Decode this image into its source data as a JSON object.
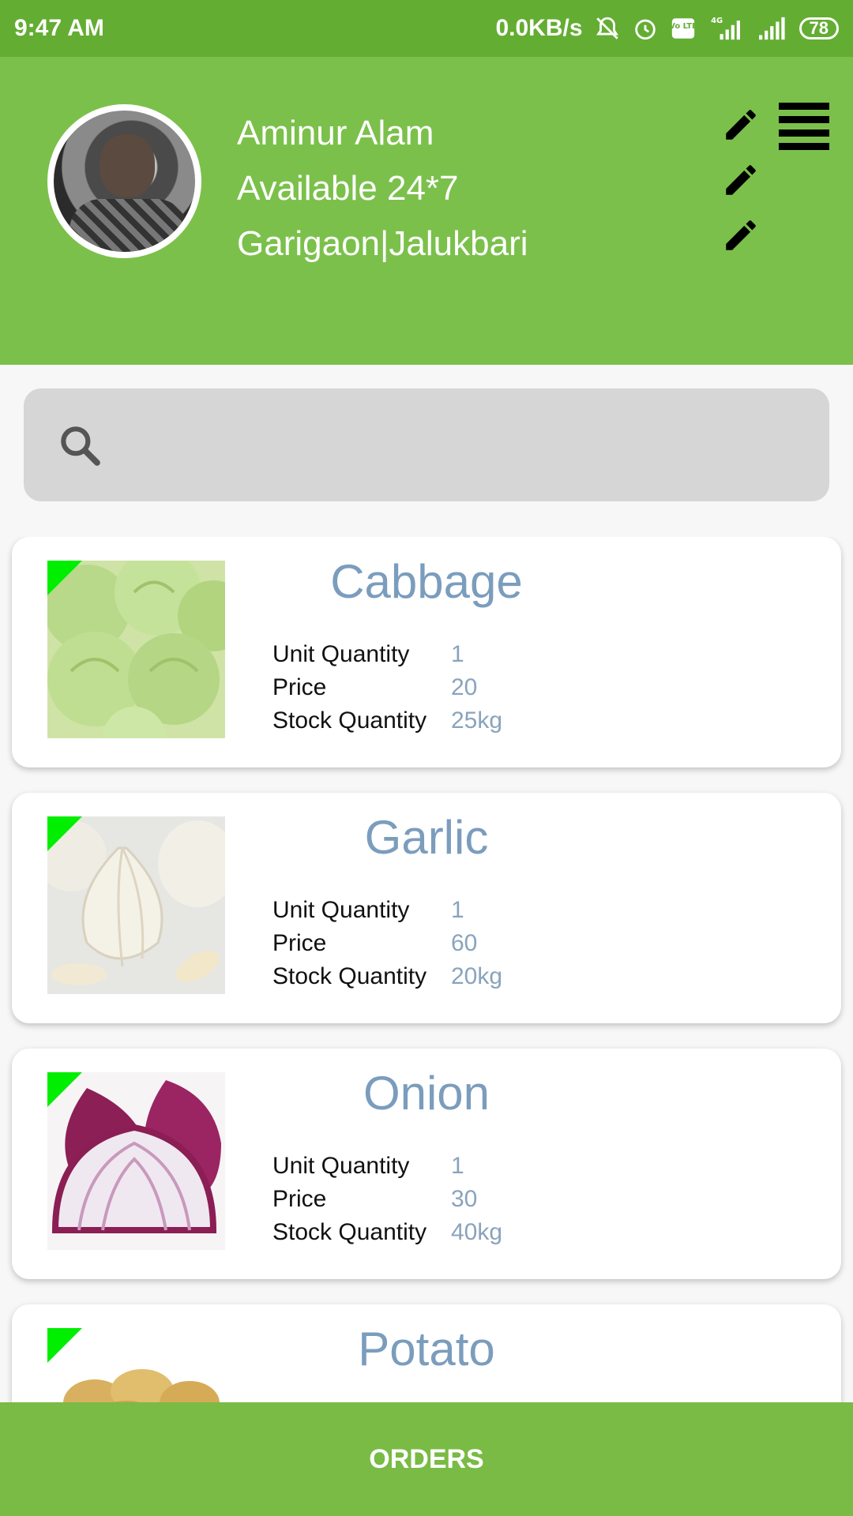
{
  "status_bar": {
    "time": "9:47 AM",
    "speed": "0.0KB/s",
    "network": "4G",
    "volte": "Vo LTE",
    "battery": "78"
  },
  "profile": {
    "name": "Aminur Alam",
    "availability": "Available 24*7",
    "location": "Garigaon|Jalukbari"
  },
  "search": {
    "placeholder": ""
  },
  "products": [
    {
      "name": "Cabbage",
      "unit_label": "Unit Quantity",
      "unit": "1",
      "price_label": "Price",
      "price": "20",
      "stock_label": "Stock Quantity",
      "stock": "25kg"
    },
    {
      "name": "Garlic",
      "unit_label": "Unit Quantity",
      "unit": "1",
      "price_label": "Price",
      "price": "60",
      "stock_label": "Stock Quantity",
      "stock": "20kg"
    },
    {
      "name": "Onion",
      "unit_label": "Unit Quantity",
      "unit": "1",
      "price_label": "Price",
      "price": "30",
      "stock_label": "Stock Quantity",
      "stock": "40kg"
    },
    {
      "name": "Potato"
    }
  ],
  "bottom_bar": {
    "label": "ORDERS"
  },
  "colors": {
    "header": "#7bc04b",
    "status_bar": "#63ad33",
    "accent_text": "#7b9dbd",
    "badge": "#00ee00"
  }
}
